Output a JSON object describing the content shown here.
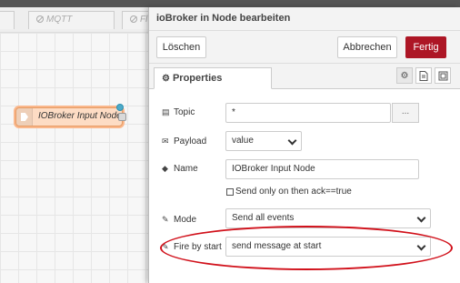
{
  "workspace": {
    "tabs": [
      "",
      "MQTT",
      "Fl"
    ],
    "node_label": "IOBroker Input Node"
  },
  "tray": {
    "title": "ioBroker in Node bearbeiten",
    "delete_label": "Löschen",
    "cancel_label": "Abbrechen",
    "done_label": "Fertig",
    "properties_tab": "Properties"
  },
  "form": {
    "topic": {
      "label": "Topic",
      "value": "*",
      "button": "..."
    },
    "payload": {
      "label": "Payload",
      "value": "value"
    },
    "name": {
      "label": "Name",
      "value": "IOBroker Input Node"
    },
    "ack_checkbox": {
      "label": "Send only on then ack==true",
      "checked": false
    },
    "mode": {
      "label": "Mode",
      "value": "Send all events"
    },
    "fire_by_start": {
      "label": "Fire by start",
      "value": "send message at start"
    }
  },
  "colors": {
    "done_button": "#ad1625",
    "node_fill": "#fddcc4",
    "highlight_ellipse": "#d1111b",
    "status_dot": "#4dabc9"
  }
}
